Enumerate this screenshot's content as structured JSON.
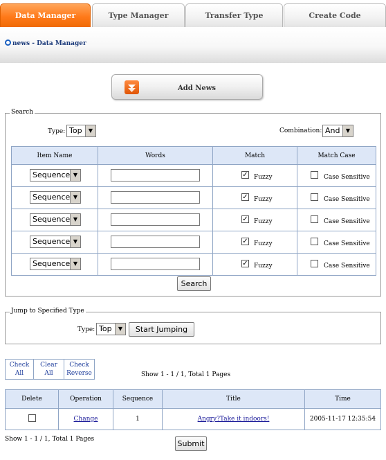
{
  "tabs": [
    {
      "label": "Data Manager",
      "active": true
    },
    {
      "label": "Type Manager",
      "active": false
    },
    {
      "label": "Transfer Type",
      "active": false
    },
    {
      "label": "Create Code",
      "active": false
    }
  ],
  "breadcrumb": "news - Data Manager",
  "add_news_label": "Add News",
  "search": {
    "legend": "Search",
    "type_label": "Type:",
    "type_value": "Top",
    "combination_label": "Combination:",
    "combination_value": "And",
    "headers": [
      "Item Name",
      "Words",
      "Match",
      "Match Case"
    ],
    "rows": [
      {
        "item": "Sequence",
        "words": "",
        "fuzzy_checked": true,
        "fuzzy_label": "Fuzzy",
        "case_checked": false,
        "case_label": "Case Sensitive"
      },
      {
        "item": "Sequence",
        "words": "",
        "fuzzy_checked": true,
        "fuzzy_label": "Fuzzy",
        "case_checked": false,
        "case_label": "Case Sensitive"
      },
      {
        "item": "Sequence",
        "words": "",
        "fuzzy_checked": true,
        "fuzzy_label": "Fuzzy",
        "case_checked": false,
        "case_label": "Case Sensitive"
      },
      {
        "item": "Sequence",
        "words": "",
        "fuzzy_checked": true,
        "fuzzy_label": "Fuzzy",
        "case_checked": false,
        "case_label": "Case Sensitive"
      },
      {
        "item": "Sequence",
        "words": "",
        "fuzzy_checked": true,
        "fuzzy_label": "Fuzzy",
        "case_checked": false,
        "case_label": "Case Sensitive"
      }
    ],
    "button": "Search"
  },
  "jump": {
    "legend": "Jump to Specified Type",
    "type_label": "Type:",
    "type_value": "Top",
    "button": "Start Jumping"
  },
  "check_buttons": {
    "check_all": [
      "Check",
      "All"
    ],
    "clear_all": "Clear All",
    "check_reverse": [
      "Check",
      "Reverse"
    ]
  },
  "pager_top": "Show 1 - 1 / 1, Total 1 Pages",
  "list": {
    "headers": [
      "Delete",
      "Operation",
      "Sequence",
      "Title",
      "Time"
    ],
    "rows": [
      {
        "delete_checked": false,
        "operation": "Change",
        "sequence": "1",
        "title": "Angry?Take it indoors!",
        "time": "2005-11-17 12:35:54"
      }
    ]
  },
  "pager_bottom": "Show 1 - 1 / 1, Total 1 Pages",
  "submit_label": "Submit"
}
